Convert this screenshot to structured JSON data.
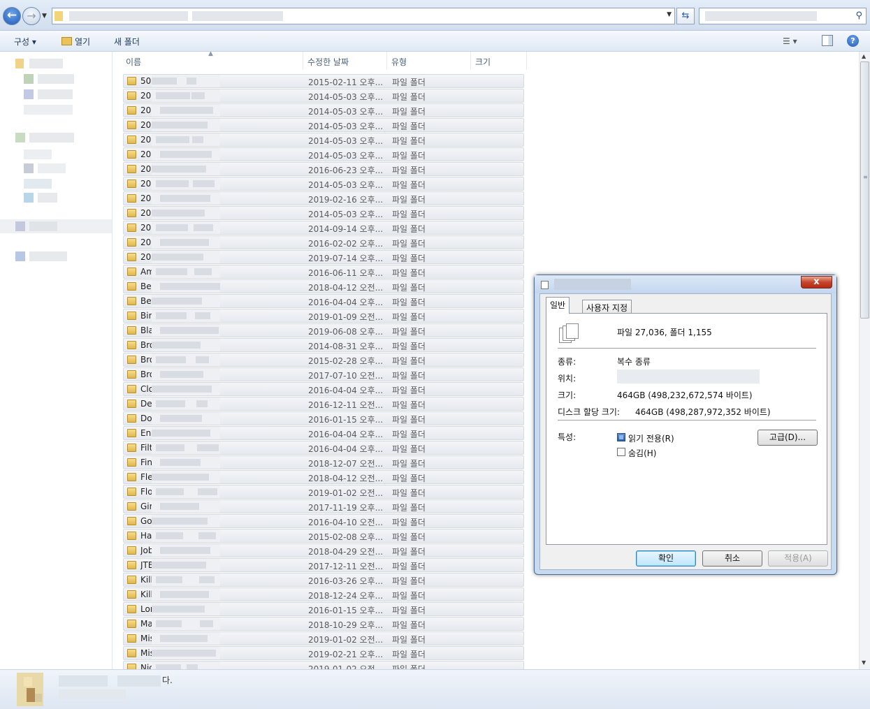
{
  "toolbar": {
    "organize": "구성 ▾",
    "open": "열기",
    "new_folder": "새 폴더"
  },
  "columns": {
    "name": "이름",
    "modified": "수정한 날짜",
    "type": "유형",
    "size": "크기"
  },
  "rows": [
    {
      "name": "50",
      "date": "2015-02-11 오후...",
      "type": "파일 폴더"
    },
    {
      "name": "20",
      "date": "2014-05-03 오후...",
      "type": "파일 폴더"
    },
    {
      "name": "20",
      "date": "2014-05-03 오후...",
      "type": "파일 폴더"
    },
    {
      "name": "20",
      "date": "2014-05-03 오후...",
      "type": "파일 폴더"
    },
    {
      "name": "20",
      "date": "2014-05-03 오후...",
      "type": "파일 폴더"
    },
    {
      "name": "20",
      "date": "2014-05-03 오후...",
      "type": "파일 폴더"
    },
    {
      "name": "20",
      "date": "2016-06-23 오후...",
      "type": "파일 폴더"
    },
    {
      "name": "20",
      "date": "2014-05-03 오후...",
      "type": "파일 폴더"
    },
    {
      "name": "20",
      "date": "2019-02-16 오후...",
      "type": "파일 폴더"
    },
    {
      "name": "20",
      "date": "2014-05-03 오후...",
      "type": "파일 폴더"
    },
    {
      "name": "20",
      "date": "2014-09-14 오후...",
      "type": "파일 폴더"
    },
    {
      "name": "20",
      "date": "2016-02-02 오후...",
      "type": "파일 폴더"
    },
    {
      "name": "20",
      "date": "2019-07-14 오후...",
      "type": "파일 폴더"
    },
    {
      "name": "Am",
      "date": "2016-06-11 오후...",
      "type": "파일 폴더"
    },
    {
      "name": "Bea",
      "date": "2018-04-12 오전...",
      "type": "파일 폴더"
    },
    {
      "name": "Bef",
      "date": "2016-04-04 오후...",
      "type": "파일 폴더"
    },
    {
      "name": "Bir",
      "date": "2019-01-09 오전...",
      "type": "파일 폴더"
    },
    {
      "name": "Bla",
      "date": "2019-06-08 오후...",
      "type": "파일 폴더"
    },
    {
      "name": "Bro",
      "date": "2014-08-31 오후...",
      "type": "파일 폴더"
    },
    {
      "name": "Bro",
      "date": "2015-02-28 오후...",
      "type": "파일 폴더"
    },
    {
      "name": "Bro",
      "date": "2017-07-10 오전...",
      "type": "파일 폴더"
    },
    {
      "name": "Clo",
      "date": "2016-04-04 오후...",
      "type": "파일 폴더"
    },
    {
      "name": "De",
      "date": "2016-12-11 오전...",
      "type": "파일 폴더"
    },
    {
      "name": "Do",
      "date": "2016-01-15 오후...",
      "type": "파일 폴더"
    },
    {
      "name": "Ene",
      "date": "2016-04-04 오후...",
      "type": "파일 폴더"
    },
    {
      "name": "Filt",
      "date": "2016-04-04 오후...",
      "type": "파일 폴더"
    },
    {
      "name": "Fin",
      "date": "2018-12-07 오전...",
      "type": "파일 폴더"
    },
    {
      "name": "Fle",
      "date": "2018-04-12 오전...",
      "type": "파일 폴더"
    },
    {
      "name": "Flo",
      "date": "2019-01-02 오전...",
      "type": "파일 폴더"
    },
    {
      "name": "Gir",
      "date": "2017-11-19 오후...",
      "type": "파일 폴더"
    },
    {
      "name": "Go",
      "date": "2016-04-10 오전...",
      "type": "파일 폴더"
    },
    {
      "name": "Ha",
      "date": "2015-02-08 오후...",
      "type": "파일 폴더"
    },
    {
      "name": "Job",
      "date": "2018-04-29 오전...",
      "type": "파일 폴더"
    },
    {
      "name": "JTB",
      "date": "2017-12-11 오전...",
      "type": "파일 폴더"
    },
    {
      "name": "Kill",
      "date": "2016-03-26 오후...",
      "type": "파일 폴더"
    },
    {
      "name": "Kill",
      "date": "2018-12-24 오후...",
      "type": "파일 폴더"
    },
    {
      "name": "Lor",
      "date": "2016-01-15 오후...",
      "type": "파일 폴더"
    },
    {
      "name": "Ma",
      "date": "2018-10-29 오후...",
      "type": "파일 폴더"
    },
    {
      "name": "Mis",
      "date": "2019-01-02 오전...",
      "type": "파일 폴더"
    },
    {
      "name": "Mis",
      "date": "2019-02-21 오후...",
      "type": "파일 폴더"
    },
    {
      "name": "Nic",
      "date": "2019-01-02 오전...",
      "type": "파일 폴더"
    }
  ],
  "status": {
    "text": "다."
  },
  "dialog": {
    "close": "x",
    "tabs": {
      "general": "일반",
      "custom": "사용자 지정"
    },
    "contains": "파일 27,036, 폴더 1,155",
    "type_label": "종류:",
    "type_value": "복수 종류",
    "location_label": "위치:",
    "size_label": "크기:",
    "size_value": "464GB (498,232,672,574 바이트)",
    "disk_label": "디스크 할당 크기:",
    "disk_value": "464GB (498,287,972,352 바이트)",
    "attributes_label": "특성:",
    "readonly_label": "읽기 전용(R)",
    "hidden_label": "숨김(H)",
    "advanced_button": "고급(D)...",
    "ok": "확인",
    "cancel": "취소",
    "apply": "적용(A)"
  }
}
